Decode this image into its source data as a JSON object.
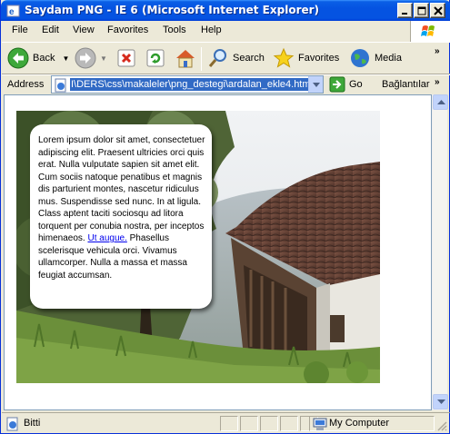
{
  "window": {
    "title": "Saydam PNG - IE 6 (Microsoft Internet Explorer)"
  },
  "menu": [
    "File",
    "Edit",
    "View",
    "Favorites",
    "Tools",
    "Help"
  ],
  "toolbar": {
    "back_label": "Back",
    "search_label": "Search",
    "favorites_label": "Favorites",
    "media_label": "Media"
  },
  "address": {
    "label": "Address",
    "url": "I\\DERS\\css\\makaleler\\png_destegi\\ardalan_ekle4.html",
    "go_label": "Go",
    "links_label": "Bağlantılar"
  },
  "content": {
    "text_before_link": "Lorem ipsum dolor sit amet, consectetuer adipiscing elit. Praesent ultricies orci quis erat. Nulla vulputate sapien sit amet elit. Cum sociis natoque penatibus et magnis dis parturient montes, nascetur ridiculus mus. Suspendisse sed nunc. In at ligula. Class aptent taciti sociosqu ad litora torquent per conubia nostra, per inceptos himenaeos. ",
    "link_text": "Ut augue.",
    "text_after_link": " Phasellus scelerisque vehicula orci. Vivamus ullamcorper. Nulla a massa et massa feugiat accumsan."
  },
  "status": {
    "left_text": "Bitti",
    "zone_text": "My Computer"
  },
  "colors": {
    "titlebar": "#0553e1",
    "selection": "#316ac5",
    "link": "#0000ee"
  }
}
